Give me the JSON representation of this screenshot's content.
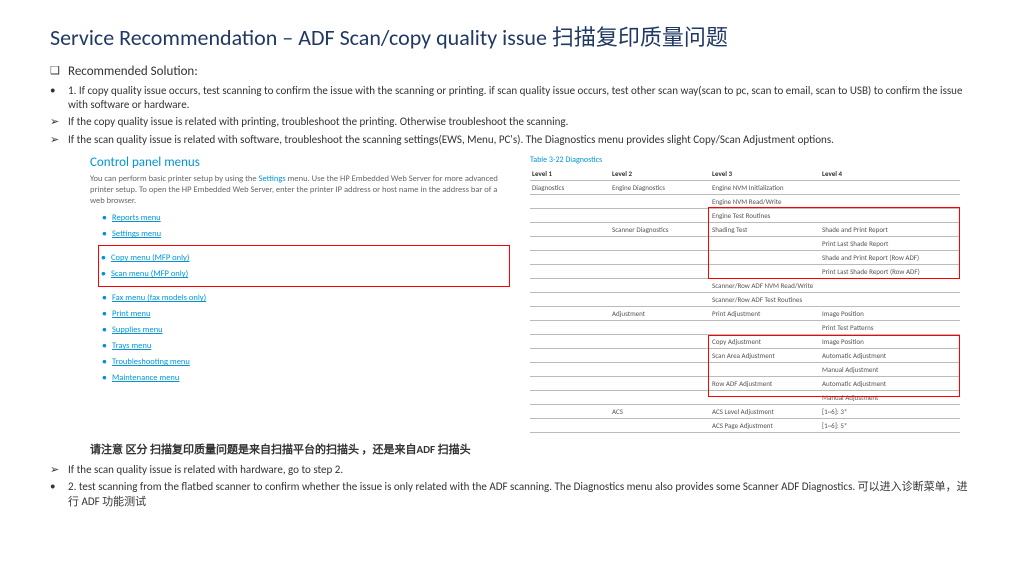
{
  "title": "Service Recommendation –  ADF Scan/copy quality issue  扫描复印质量问题",
  "rec_label": "Recommended Solution:",
  "bullets": {
    "b1": "1. If copy quality issue occurs, test scanning to confirm the issue with the scanning or printing. if scan quality issue occurs, test other scan way(scan to pc, scan to email, scan to USB) to confirm the issue with software or hardware.",
    "b2": "If the copy quality issue is related with printing, troubleshoot the printing. Otherwise troubleshoot the scanning.",
    "b3": "If the scan quality issue is related with software, troubleshoot the scanning settings(EWS, Menu, PC's). The Diagnostics menu provides slight Copy/Scan Adjustment options.",
    "b4": "If the scan quality issue is related with hardware, go to step 2.",
    "b5": "2. test scanning from the flatbed scanner to confirm whether the issue is only related with the ADF scanning. The Diagnostics menu also provides some Scanner ADF Diagnostics. 可以进入诊断菜单，进行 ADF 功能测试"
  },
  "note_cn": "请注意 区分 扫描复印质量问题是来自扫描平台的扫描头 ，还是来自ADF 扫描头",
  "panel": {
    "title": "Control panel menus",
    "desc1": "You can perform basic printer setup by using the ",
    "desc_link": "Settings",
    "desc2": " menu. Use the HP Embedded Web Server for more advanced printer setup. To open the HP Embedded Web Server, enter the printer IP address or host name in the address bar of a web browser.",
    "items": [
      "Reports menu",
      "Settings menu",
      "Copy menu (MFP only)",
      "Scan menu (MFP only)",
      "Fax menu (fax models only)",
      "Print menu",
      "Supplies menu",
      "Trays menu",
      "Troubleshooting menu",
      "Maintenance menu"
    ]
  },
  "diag": {
    "title": "Table 3-22  Diagnostics",
    "head": [
      "Level 1",
      "Level 2",
      "Level 3",
      "Level 4"
    ],
    "rows": [
      [
        "Diagnostics",
        "Engine Diagnostics",
        "Engine NVM Initialization",
        ""
      ],
      [
        "",
        "",
        "Engine NVM Read/Write",
        ""
      ],
      [
        "",
        "",
        "Engine Test Routines",
        ""
      ],
      [
        "",
        "Scanner Diagnostics",
        "Shading Test",
        "Shade and Print Report"
      ],
      [
        "",
        "",
        "",
        "Print Last Shade Report"
      ],
      [
        "",
        "",
        "",
        "Shade and Print Report (Row ADF)"
      ],
      [
        "",
        "",
        "",
        "Print Last Shade Report (Row ADF)"
      ],
      [
        "",
        "",
        "Scanner/Row ADF NVM Read/Write",
        ""
      ],
      [
        "",
        "",
        "Scanner/Row ADF Test Routines",
        ""
      ],
      [
        "",
        "Adjustment",
        "Print Adjustment",
        "Image Position"
      ],
      [
        "",
        "",
        "",
        "Print Test Patterns"
      ],
      [
        "",
        "",
        "Copy Adjustment",
        "Image Position"
      ],
      [
        "",
        "",
        "Scan Area Adjustment",
        "Automatic Adjustment"
      ],
      [
        "",
        "",
        "",
        "Manual Adjustment"
      ],
      [
        "",
        "",
        "Row ADF Adjustment",
        "Automatic Adjustment"
      ],
      [
        "",
        "",
        "",
        "Manual Adjustment"
      ],
      [
        "",
        "ACS",
        "ACS Level Adjustment",
        "[1~6]: 3*"
      ],
      [
        "",
        "",
        "ACS Page Adjustment",
        "[1~6]: 5*"
      ]
    ]
  }
}
